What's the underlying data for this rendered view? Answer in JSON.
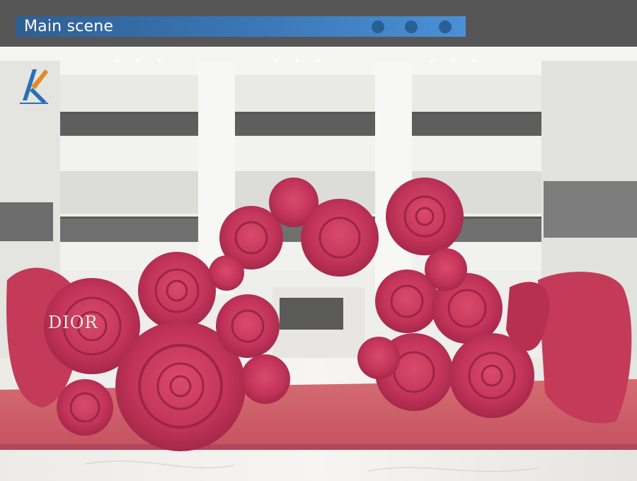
{
  "header": {
    "title": "Main scene",
    "indicator_dots": 3
  },
  "scene": {
    "brand_text": "DIOR",
    "logo": "shopping-mall-brand-logo"
  },
  "colors": {
    "header_bg": "#565656",
    "title_band": "#3b78b8",
    "dot": "#2a5f95",
    "rose": "#c9385a",
    "rose_dark": "#a82a48",
    "floor": "#c85a64",
    "ceiling": "#f3f3f1"
  }
}
